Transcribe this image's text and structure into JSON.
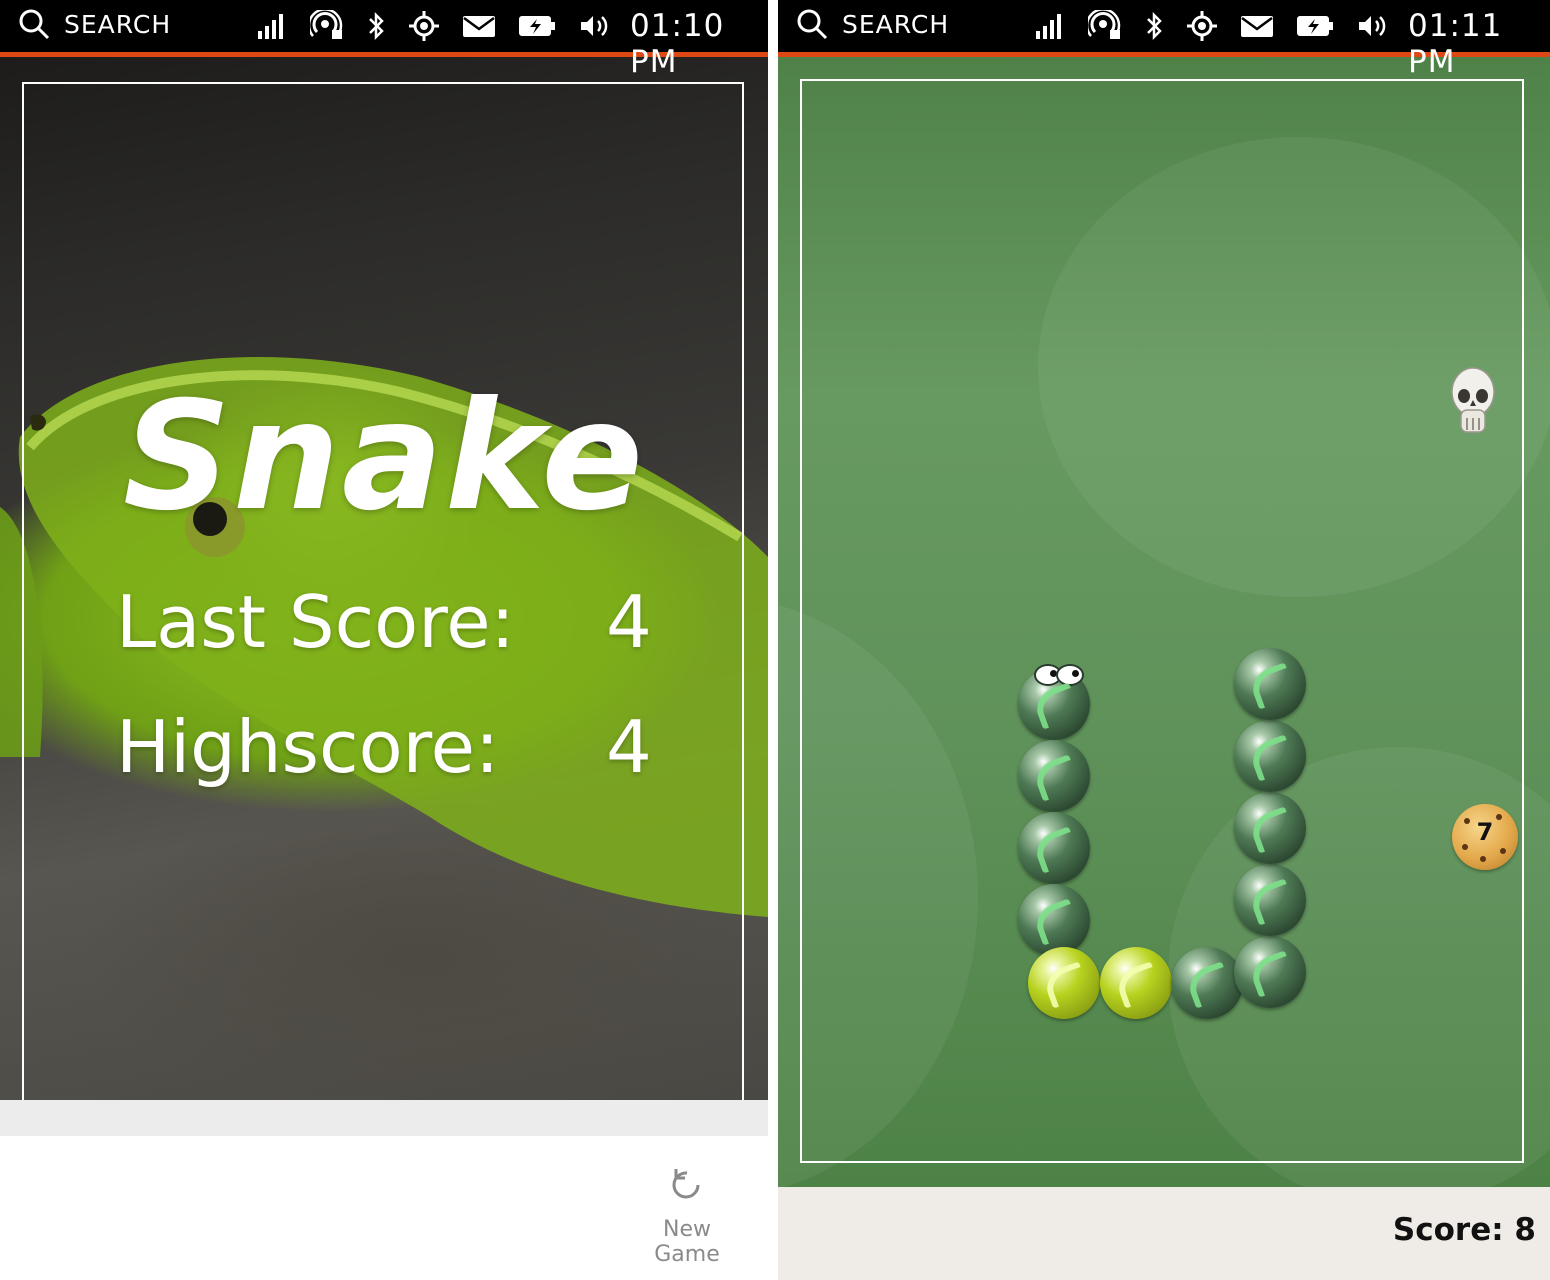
{
  "left": {
    "status": {
      "search": "SEARCH",
      "time": "01:10 PM"
    },
    "title": "Snake",
    "last_score_label": "Last Score:",
    "last_score": "4",
    "highscore_label": "Highscore:",
    "highscore": "4",
    "new_game_label": "New Game"
  },
  "right": {
    "status": {
      "search": "SEARCH",
      "time": "01:11 PM"
    },
    "cookie_value": "7",
    "score_label": "Score: 8"
  },
  "colors": {
    "accent": "#dd4814",
    "board": "#5f925a"
  }
}
